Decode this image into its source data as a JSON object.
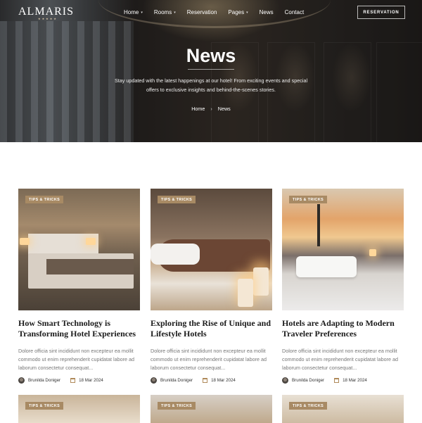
{
  "brand": {
    "name": "ALMARIS",
    "sub": "★★★★★"
  },
  "nav": {
    "items": [
      {
        "label": "Home",
        "caret": "▾"
      },
      {
        "label": "Rooms",
        "caret": "▾"
      },
      {
        "label": "Reservation",
        "caret": ""
      },
      {
        "label": "Pages",
        "caret": "▾"
      },
      {
        "label": "News",
        "caret": ""
      },
      {
        "label": "Contact",
        "caret": ""
      }
    ],
    "cta": "RESERVATION"
  },
  "hero": {
    "title": "News",
    "description": "Stay updated with the latest happenings at our hotel! From exciting events and special offers to exclusive insights and behind-the-scenes stories.",
    "breadcrumb": {
      "home": "Home",
      "separator": "›",
      "current": "News"
    }
  },
  "posts": [
    {
      "tag": "TIPS & TRICKS",
      "title": "How Smart Technology is Transforming Hotel Experiences",
      "excerpt": "Dolore officia sint incididunt non excepteur ea mollit commodo ut enim reprehenderit cupidatat labore ad laborum consectetur consequat...",
      "author": "Brunilda Doniger",
      "date": "18 Mar 2024"
    },
    {
      "tag": "TIPS & TRICKS",
      "title": "Exploring the Rise of Unique and Lifestyle Hotels",
      "excerpt": "Dolore officia sint incididunt non excepteur ea mollit commodo ut enim reprehenderit cupidatat labore ad laborum consectetur consequat...",
      "author": "Brunilda Doniger",
      "date": "18 Mar 2024"
    },
    {
      "tag": "TIPS & TRICKS",
      "title": "Hotels are Adapting to Modern Traveler Preferences",
      "excerpt": "Dolore officia sint incididunt non excepteur ea mollit commodo ut enim reprehenderit cupidatat labore ad laborum consectetur consequat...",
      "author": "Brunilda Doniger",
      "date": "18 Mar 2024"
    }
  ],
  "posts_row2": [
    {
      "tag": "TIPS & TRICKS"
    },
    {
      "tag": "TIPS & TRICKS"
    },
    {
      "tag": "TIPS & TRICKS"
    }
  ],
  "icons": {
    "author": "avatar",
    "date": "calendar-icon",
    "menu_caret": "chevron-down-icon"
  },
  "colors": {
    "accent": "#a88a64",
    "text": "#1b1b1b",
    "muted": "#777777"
  }
}
